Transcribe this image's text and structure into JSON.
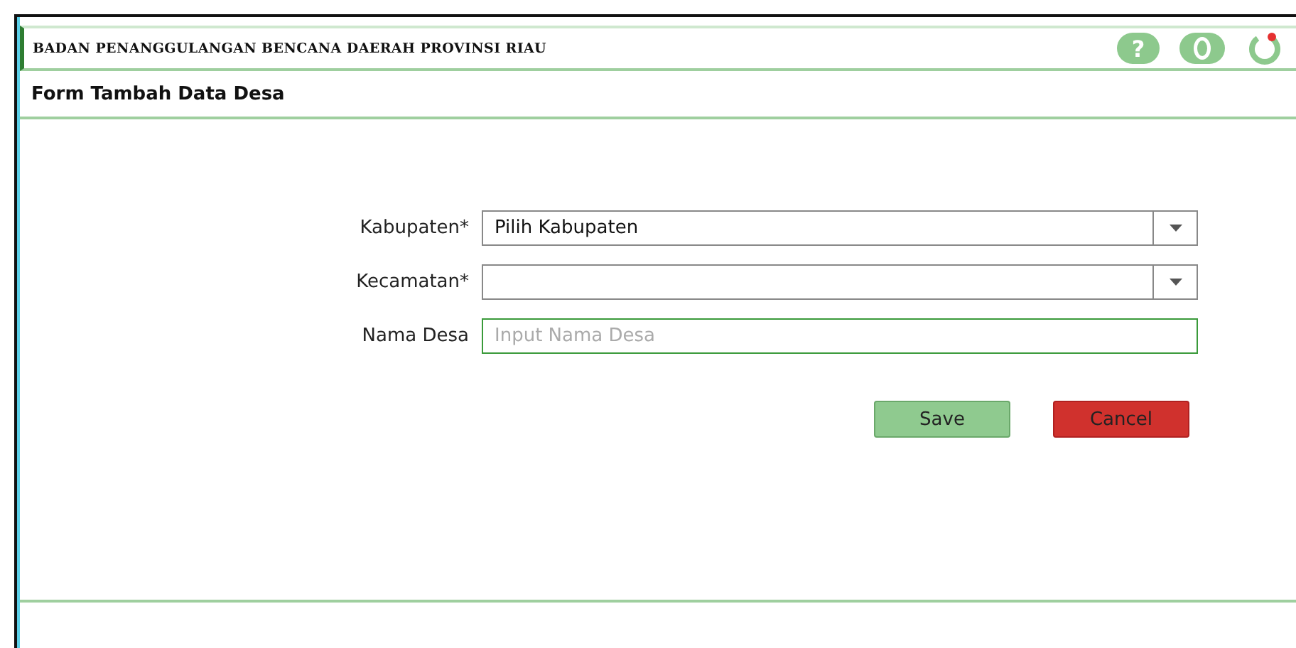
{
  "header": {
    "title": "BADAN PENANGGULANGAN BENCANA DAERAH PROVINSI RIAU",
    "icons": [
      {
        "kind": "help",
        "glyph": "?"
      },
      {
        "kind": "user"
      },
      {
        "kind": "power"
      }
    ]
  },
  "form": {
    "title": "Form Tambah Data Desa",
    "fields": [
      {
        "kind": "select",
        "label": "Kabupaten*",
        "value": "Pilih Kabupaten"
      },
      {
        "kind": "select",
        "label": "Kecamatan*"
      },
      {
        "kind": "text",
        "label": "Nama Desa",
        "placeholder": "Input Nama Desa"
      }
    ],
    "buttons": [
      {
        "kind": "primary",
        "label": "Save"
      },
      {
        "kind": "danger",
        "label": "Cancel"
      }
    ]
  }
}
